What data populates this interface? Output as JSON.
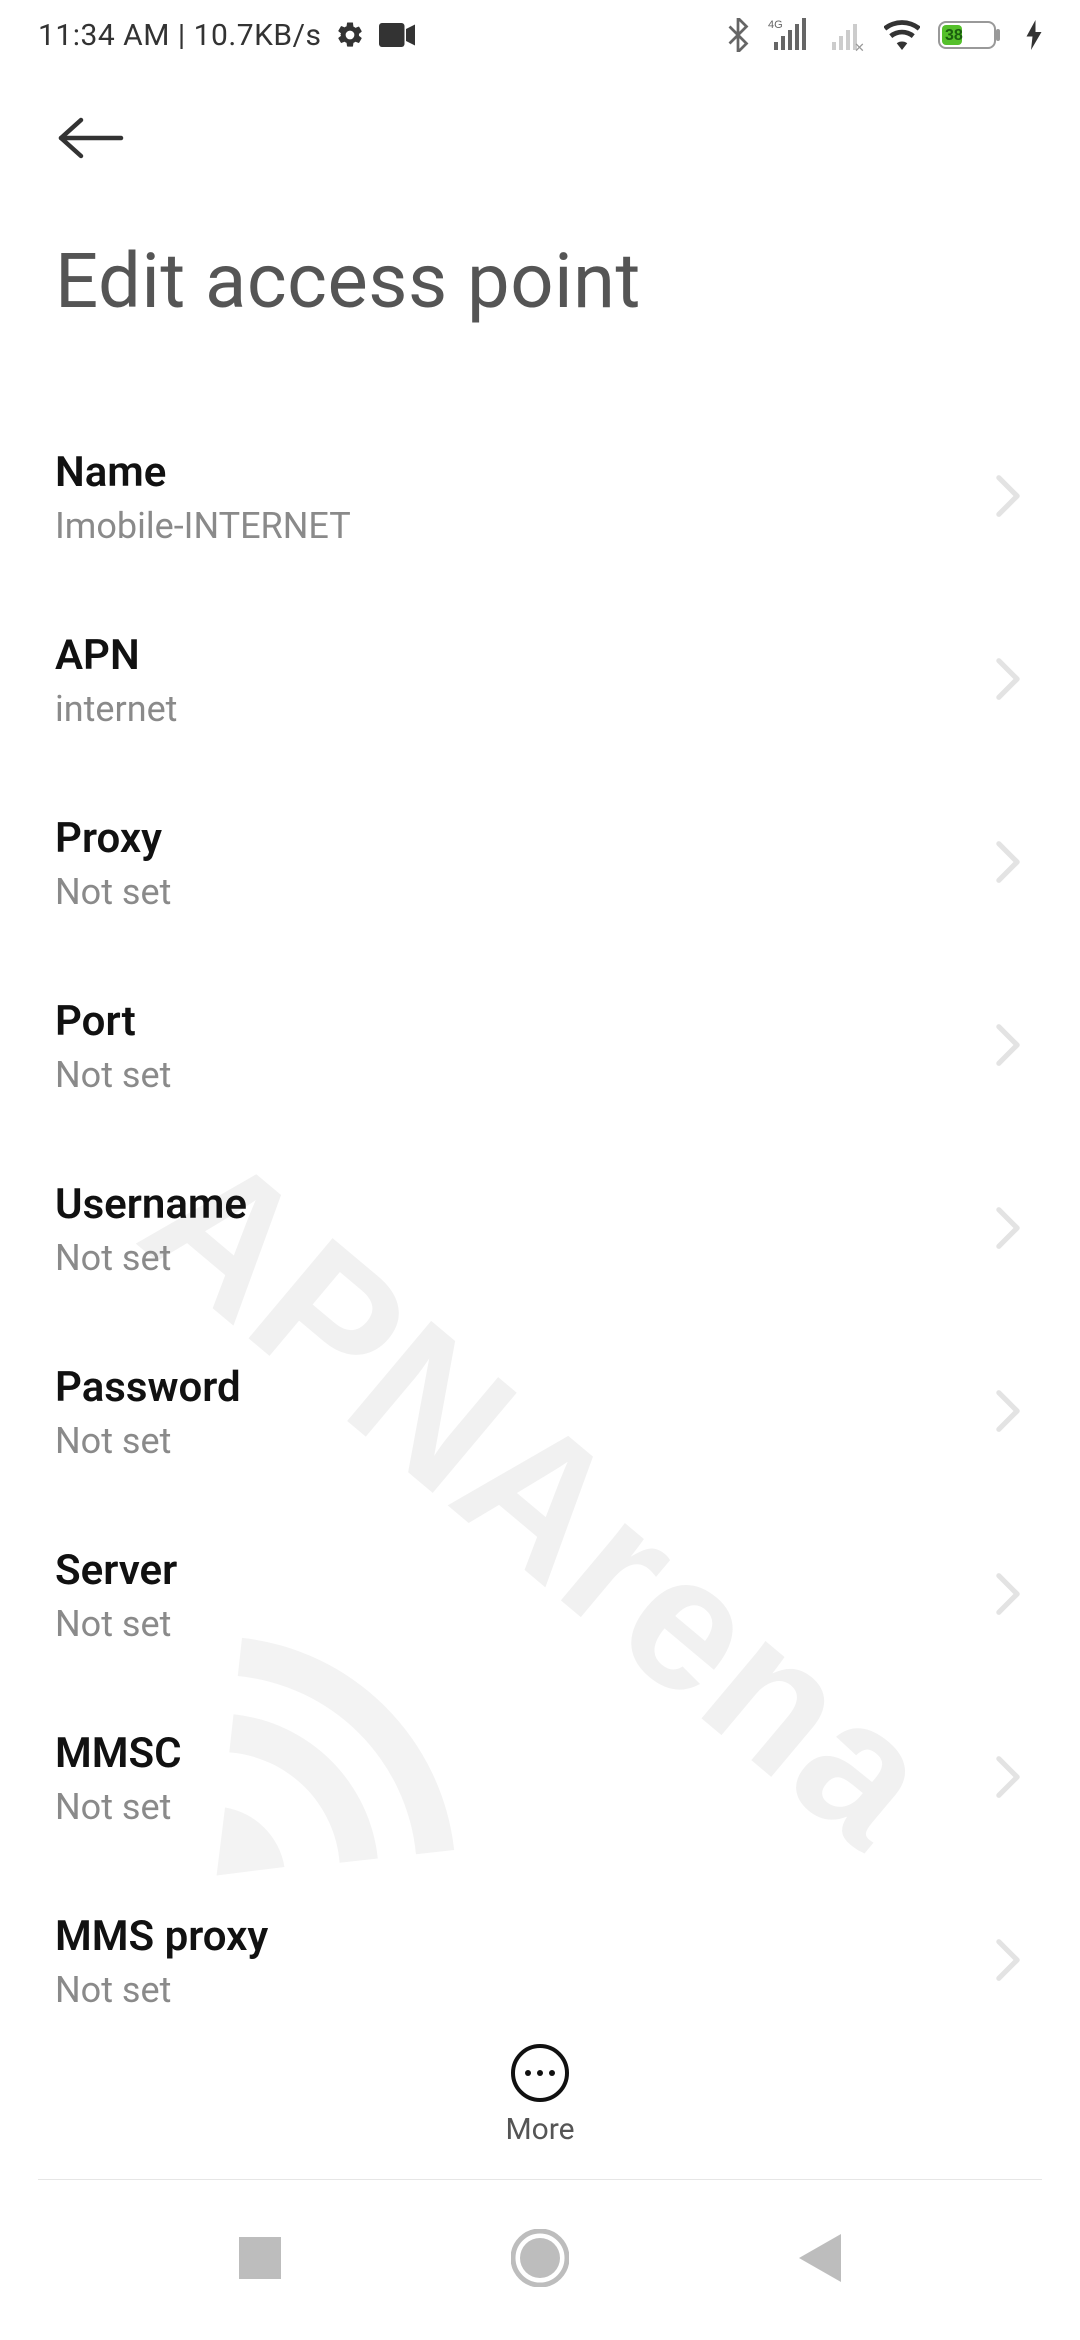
{
  "status_bar": {
    "clock_text": "11:34 AM | 10.7KB/s",
    "battery_percent": "38"
  },
  "header": {
    "title": "Edit access point"
  },
  "watermark_text": "APNArena",
  "settings": [
    {
      "label": "Name",
      "value": "Imobile-INTERNET"
    },
    {
      "label": "APN",
      "value": "internet"
    },
    {
      "label": "Proxy",
      "value": "Not set"
    },
    {
      "label": "Port",
      "value": "Not set"
    },
    {
      "label": "Username",
      "value": "Not set"
    },
    {
      "label": "Password",
      "value": "Not set"
    },
    {
      "label": "Server",
      "value": "Not set"
    },
    {
      "label": "MMSC",
      "value": "Not set"
    },
    {
      "label": "MMS proxy",
      "value": "Not set"
    }
  ],
  "bottom_action": {
    "label": "More"
  }
}
